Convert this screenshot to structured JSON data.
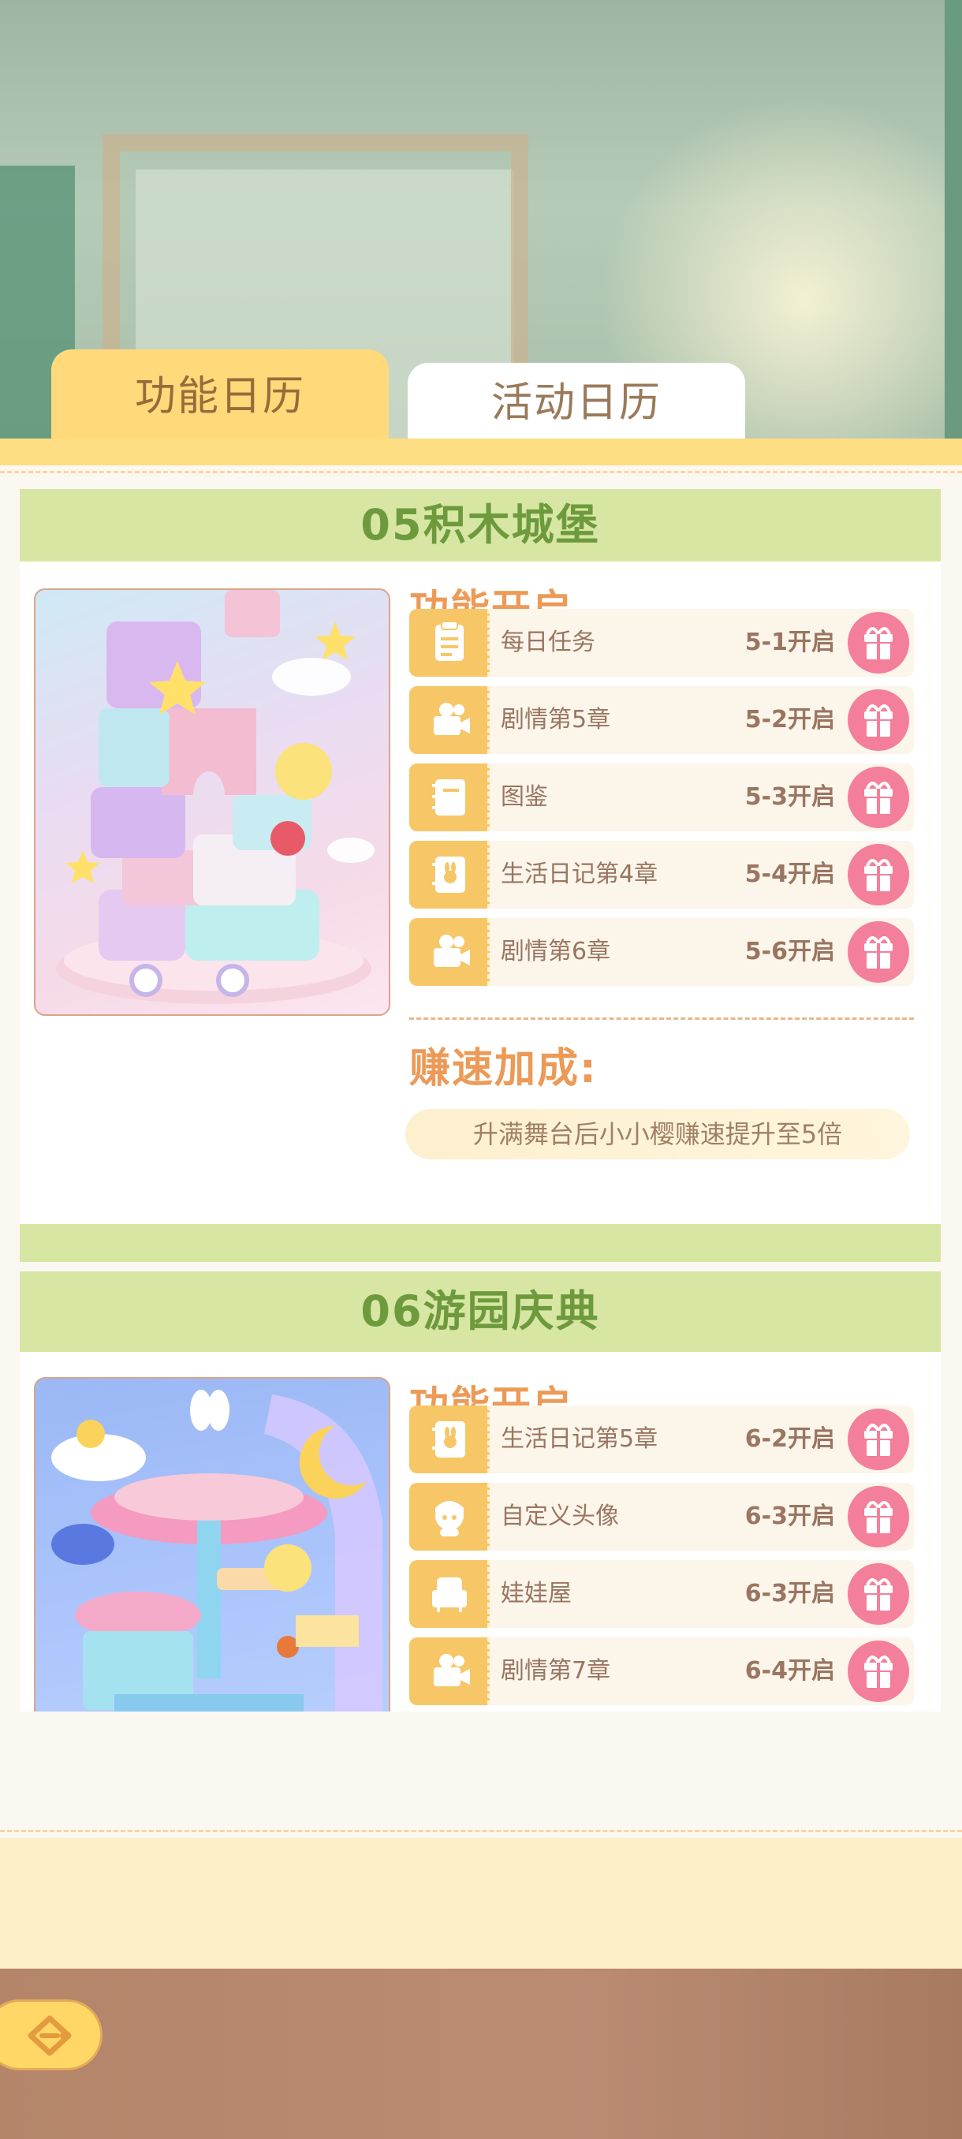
{
  "tabs": [
    {
      "label": "功能日历",
      "active": true
    },
    {
      "label": "活动日历",
      "active": false
    }
  ],
  "sections": [
    {
      "title": "05积木城堡",
      "features_title": "功能开启",
      "features": [
        {
          "icon": "task-clipboard-icon",
          "name": "每日任务",
          "unlock": "5-1开启"
        },
        {
          "icon": "camera-icon",
          "name": "剧情第5章",
          "unlock": "5-2开启"
        },
        {
          "icon": "book-icon",
          "name": "图鉴",
          "unlock": "5-3开启"
        },
        {
          "icon": "diary-icon",
          "name": "生活日记第4章",
          "unlock": "5-4开启"
        },
        {
          "icon": "camera-icon",
          "name": "剧情第6章",
          "unlock": "5-6开启"
        }
      ],
      "bonus_title": "赚速加成:",
      "bonus_text": "升满舞台后小小樱赚速提升至5倍"
    },
    {
      "title": "06游园庆典",
      "features_title": "功能开启",
      "features": [
        {
          "icon": "diary-icon",
          "name": "生活日记第5章",
          "unlock": "6-2开启"
        },
        {
          "icon": "avatar-icon",
          "name": "自定义头像",
          "unlock": "6-3开启"
        },
        {
          "icon": "dollhouse-icon",
          "name": "娃娃屋",
          "unlock": "6-3开启"
        },
        {
          "icon": "camera-icon",
          "name": "剧情第7章",
          "unlock": "6-4开启"
        }
      ]
    }
  ],
  "colors": {
    "tab_active": "#ffd97a",
    "section_header": "#d7e6a2",
    "section_title": "#6e9a3e",
    "accent_orange": "#ec9a57",
    "icon_tile": "#f7c667",
    "gift_button": "#f47f9b"
  }
}
